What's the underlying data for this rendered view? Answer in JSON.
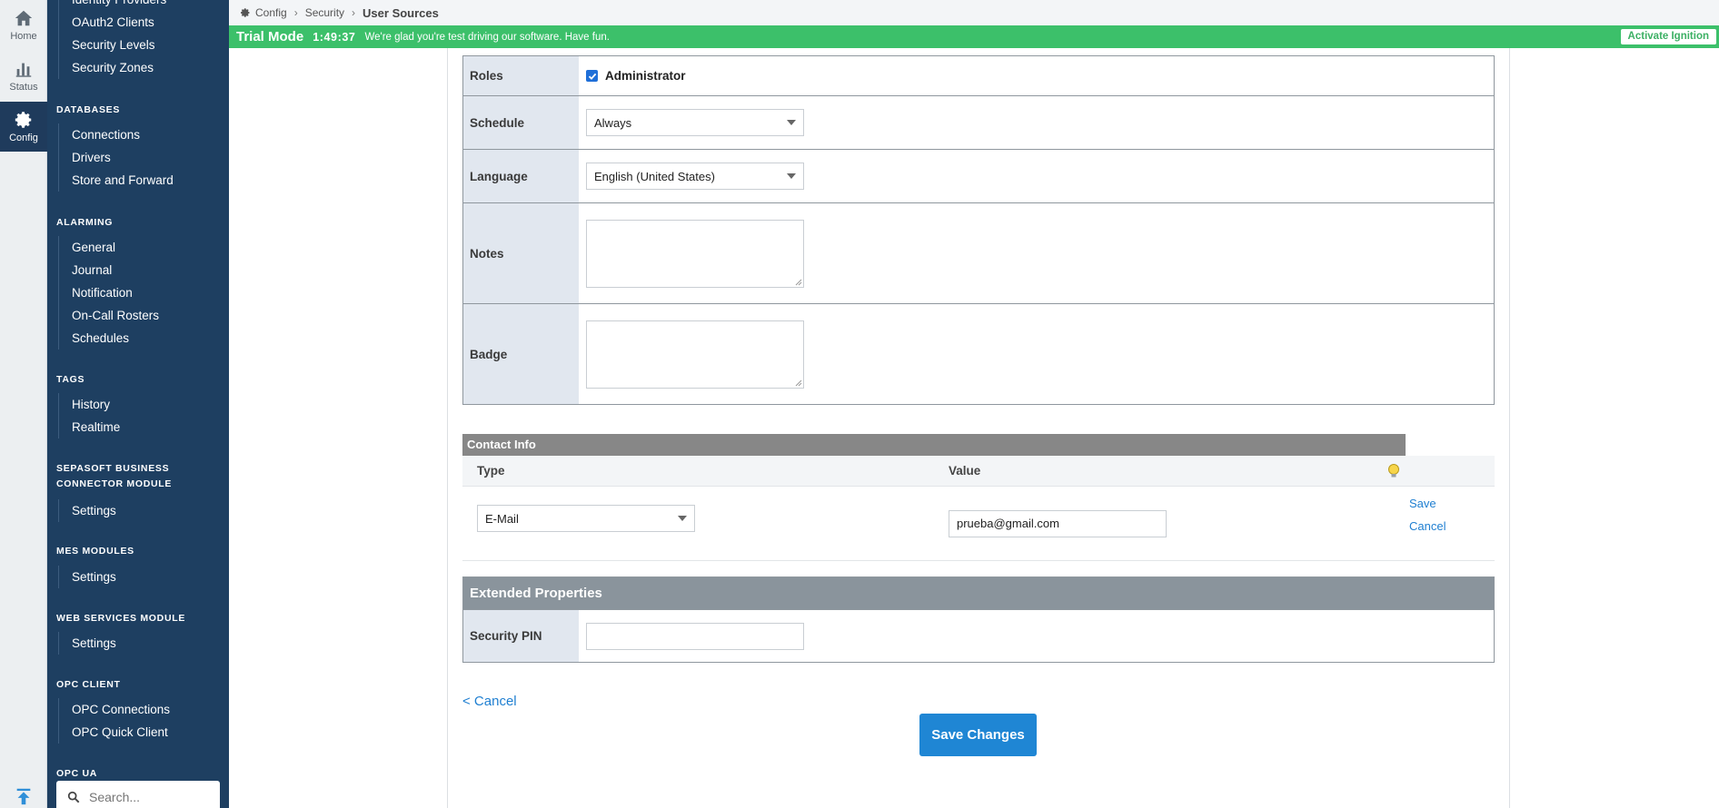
{
  "rail": {
    "home_label": "Home",
    "status_label": "Status",
    "config_label": "Config"
  },
  "nav": {
    "security_items": [
      "Identity Providers",
      "OAuth2 Clients",
      "Security Levels",
      "Security Zones"
    ],
    "databases": {
      "title": "DATABASES",
      "items": [
        "Connections",
        "Drivers",
        "Store and Forward"
      ]
    },
    "alarming": {
      "title": "ALARMING",
      "items": [
        "General",
        "Journal",
        "Notification",
        "On-Call Rosters",
        "Schedules"
      ]
    },
    "tags": {
      "title": "TAGS",
      "items": [
        "History",
        "Realtime"
      ]
    },
    "sepasoft": {
      "title": "SEPASOFT BUSINESS CONNECTOR MODULE",
      "items": [
        "Settings"
      ]
    },
    "mes": {
      "title": "MES MODULES",
      "items": [
        "Settings"
      ]
    },
    "webservices": {
      "title": "WEB SERVICES MODULE",
      "items": [
        "Settings"
      ]
    },
    "opc_client": {
      "title": "OPC CLIENT",
      "items": [
        "OPC Connections",
        "OPC Quick Client"
      ]
    },
    "opc_ua": {
      "title": "OPC UA"
    },
    "search_placeholder": "Search..."
  },
  "breadcrumb": {
    "config": "Config",
    "security": "Security",
    "current": "User Sources"
  },
  "trial": {
    "title": "Trial Mode",
    "time": "1:49:37",
    "message": "We're glad you're test driving our software. Have fun.",
    "activate": "Activate Ignition"
  },
  "form": {
    "roles_label": "Roles",
    "role_admin": "Administrator",
    "schedule_label": "Schedule",
    "schedule_value": "Always",
    "language_label": "Language",
    "language_value": "English (United States)",
    "notes_label": "Notes",
    "badge_label": "Badge"
  },
  "contact": {
    "header": "Contact Info",
    "col_type": "Type",
    "col_value": "Value",
    "type_value": "E-Mail",
    "email_value": "prueba@gmail.com",
    "save": "Save",
    "cancel": "Cancel"
  },
  "extended": {
    "header": "Extended Properties",
    "pin_label": "Security PIN"
  },
  "actions": {
    "cancel": "< Cancel",
    "save_changes": "Save Changes"
  },
  "colors": {
    "sidebar": "#1e3f61",
    "trial_banner": "#3cc06a",
    "primary_button": "#1f86d4",
    "link": "#1f7fd1"
  }
}
